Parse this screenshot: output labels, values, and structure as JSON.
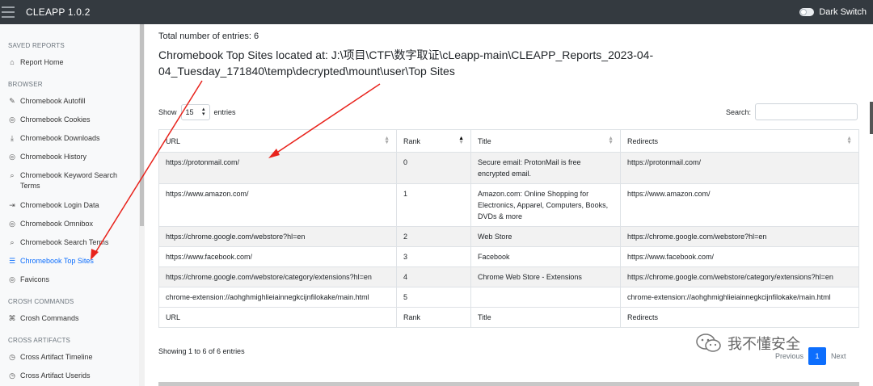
{
  "app": {
    "title": "CLEAPP 1.0.2",
    "dark_switch_label": "Dark Switch"
  },
  "sidebar": {
    "sections": [
      {
        "heading": "SAVED REPORTS",
        "items": [
          {
            "label": "Report Home",
            "icon": "home-icon",
            "glyph": "⌂"
          }
        ]
      },
      {
        "heading": "BROWSER",
        "items": [
          {
            "label": "Chromebook Autofill",
            "icon": "edit-icon",
            "glyph": "✎"
          },
          {
            "label": "Chromebook Cookies",
            "icon": "chrome-icon",
            "glyph": "◎"
          },
          {
            "label": "Chromebook Downloads",
            "icon": "download-icon",
            "glyph": "⤓"
          },
          {
            "label": "Chromebook History",
            "icon": "chrome-icon",
            "glyph": "◎"
          },
          {
            "label": "Chromebook Keyword Search Terms",
            "icon": "search-icon",
            "glyph": "⌕"
          },
          {
            "label": "Chromebook Login Data",
            "icon": "login-icon",
            "glyph": "⇥"
          },
          {
            "label": "Chromebook Omnibox",
            "icon": "chrome-icon",
            "glyph": "◎"
          },
          {
            "label": "Chromebook Search Terms",
            "icon": "search-icon",
            "glyph": "⌕"
          },
          {
            "label": "Chromebook Top Sites",
            "icon": "list-icon",
            "glyph": "☰",
            "active": true
          },
          {
            "label": "Favicons",
            "icon": "chrome-icon",
            "glyph": "◎"
          }
        ]
      },
      {
        "heading": "CROSH COMMANDS",
        "items": [
          {
            "label": "Crosh Commands",
            "icon": "command-icon",
            "glyph": "⌘"
          }
        ]
      },
      {
        "heading": "CROSS ARTIFACTS",
        "items": [
          {
            "label": "Cross Artifact Timeline",
            "icon": "clock-icon",
            "glyph": "◷"
          },
          {
            "label": "Cross Artifact Userids",
            "icon": "clock-icon",
            "glyph": "◷"
          }
        ]
      }
    ]
  },
  "main": {
    "total_entries": "Total number of entries: 6",
    "report_title": "Chromebook Top Sites located at: J:\\项目\\CTF\\数字取证\\cLeapp-main\\CLEAPP_Reports_2023-04-04_Tuesday_171840\\temp\\decrypted\\mount\\user\\Top Sites",
    "show_label": "Show",
    "show_value": "15",
    "entries_label": "entries",
    "search_label": "Search:",
    "columns": [
      "URL",
      "Rank",
      "Title",
      "Redirects"
    ],
    "rows": [
      {
        "url": "https://protonmail.com/",
        "rank": "0",
        "title": "Secure email: ProtonMail is free encrypted email.",
        "redirects": "https://protonmail.com/"
      },
      {
        "url": "https://www.amazon.com/",
        "rank": "1",
        "title": "Amazon.com: Online Shopping for Electronics, Apparel, Computers, Books, DVDs & more",
        "redirects": "https://www.amazon.com/"
      },
      {
        "url": "https://chrome.google.com/webstore?hl=en",
        "rank": "2",
        "title": "Web Store",
        "redirects": "https://chrome.google.com/webstore?hl=en"
      },
      {
        "url": "https://www.facebook.com/",
        "rank": "3",
        "title": "Facebook",
        "redirects": "https://www.facebook.com/"
      },
      {
        "url": "https://chrome.google.com/webstore/category/extensions?hl=en",
        "rank": "4",
        "title": "Chrome Web Store - Extensions",
        "redirects": "https://chrome.google.com/webstore/category/extensions?hl=en"
      },
      {
        "url": "chrome-extension://aohghmighlieiainnegkcijnfilokake/main.html",
        "rank": "5",
        "title": "",
        "redirects": "chrome-extension://aohghmighlieiainnegkcijnfilokake/main.html"
      }
    ],
    "info": "Showing 1 to 6 of 6 entries",
    "pager": {
      "previous": "Previous",
      "page": "1",
      "next": "Next"
    }
  },
  "watermark": {
    "text": "我不懂安全"
  },
  "colors": {
    "accent": "#0d6efd",
    "annotation": "#e8231c",
    "topbar": "#343a40"
  }
}
